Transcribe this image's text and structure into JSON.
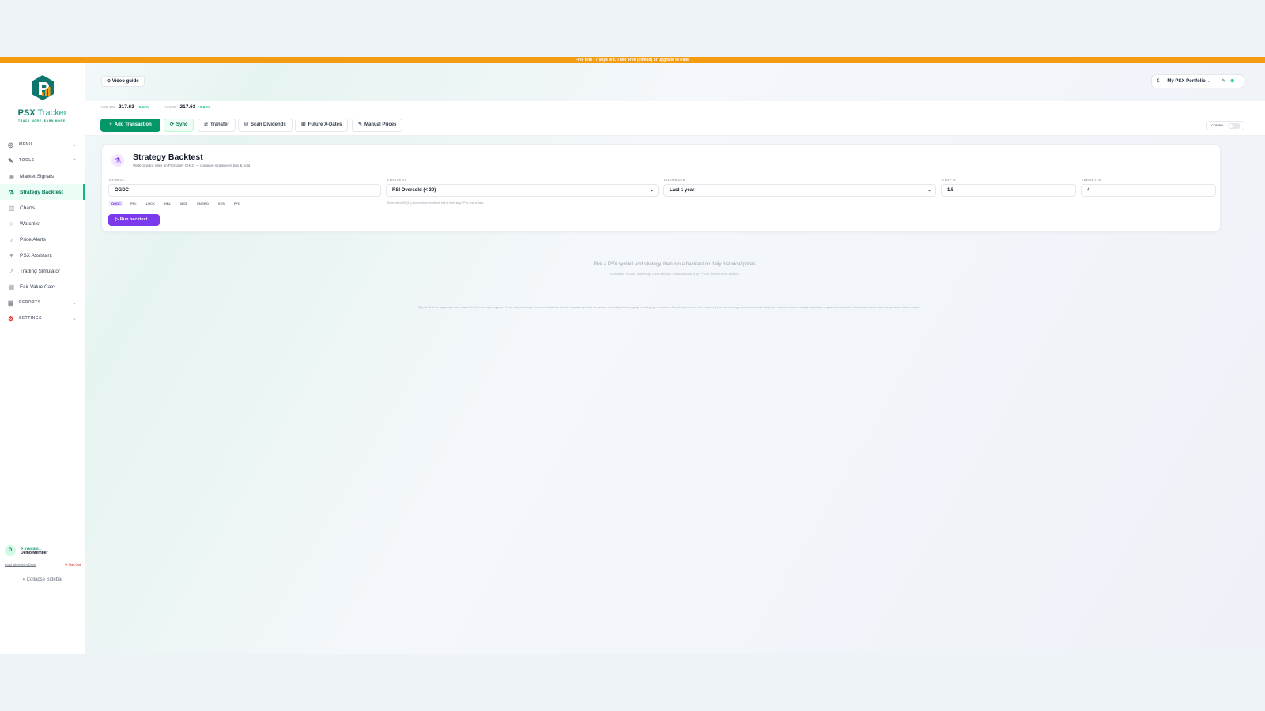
{
  "banner": "Free trial · 7 days left. Then Free (limited) or upgrade to Paid.",
  "brand": {
    "name_a": "PSX",
    "name_b": " Tracker",
    "tagline": "TRACK MORE. EARN MORE."
  },
  "colors": {
    "accent": "#059669",
    "brand": "#0f766e",
    "primary_action": "#7c3aed",
    "banner": "#f39c12"
  },
  "sidebar": {
    "menu_label": "MENU",
    "tools_label": "TOOLS",
    "items": [
      {
        "label": "Market Signals",
        "icon": "signal-icon",
        "active": false
      },
      {
        "label": "Strategy Backtest",
        "icon": "flask-icon",
        "active": true
      },
      {
        "label": "Charts",
        "icon": "chart-icon",
        "active": false
      },
      {
        "label": "Watchlist",
        "icon": "star-icon",
        "active": false
      },
      {
        "label": "Price Alerts",
        "icon": "bell-icon",
        "active": false
      },
      {
        "label": "PSX Assistant",
        "icon": "sparkle-icon",
        "active": false
      },
      {
        "label": "Trading Simulator",
        "icon": "trend-icon",
        "active": false
      },
      {
        "label": "Fair Value Calc",
        "icon": "calculator-icon",
        "active": false
      }
    ],
    "reports_label": "REPORTS",
    "settings_label": "SETTINGS",
    "user": {
      "initial": "D",
      "status": "SYNCING...",
      "name": "Demo Member",
      "load_link": "Load latest from Drive",
      "sign_out": "Sign Out"
    },
    "collapse": "Collapse Sidebar"
  },
  "header": {
    "video_guide": "Video guide",
    "portfolio": "My PSX Portfolio"
  },
  "tickers": [
    {
      "name": "KSE-100",
      "value": "217.63",
      "change": "+0.34%"
    },
    {
      "name": "KMI-30",
      "value": "217.63",
      "change": "+0.34%"
    }
  ],
  "actions": {
    "add": "Add Transaction",
    "sync": "Sync",
    "transfer": "Transfer",
    "scan": "Scan Dividends",
    "future": "Future X-Dates",
    "manual": "Manual Prices",
    "combo": "COMBO"
  },
  "backtest": {
    "title": "Strategy Backtest",
    "subtitle": "Walk-forward rules on PSX daily OHLC — compare strategy vs buy & hold",
    "symbol_label": "SYMBOL",
    "symbol_value": "OGDC",
    "strategy_label": "STRATEGY",
    "strategy_value": "RSI Oversold (< 30)",
    "lookback_label": "LOOKBACK",
    "lookback_value": "Last 1 year",
    "stop_label": "STOP %",
    "stop_value": "1.5",
    "target_label": "TARGET %",
    "target_value": "4",
    "chips": [
      "OGDC",
      "PPL",
      "LUCK",
      "HBL",
      "MCB",
      "ENGRO",
      "SYS",
      "FFC"
    ],
    "hint": "Enter when RSI(14) drops below threshold; exit at fixed stop/TP or end of data.",
    "run": "Run backtest",
    "empty_title": "Pick a PSX symbol and strategy, then run a backtest on daily historical prices.",
    "empty_sub": "Includes ~0.3% round-trip commission. Educational only — not investment advice.",
    "disclaimer": "Signals fill at the signal day close. Gaps fill at the next opening price. If both stop and target are crossed within a bar, the stop takes priority. Drawdown uses daily closing equity, including open positions. Round-trip fees are reserved at entry for both strategy and buy-and-hold. Daily bars cannot measure intraday drawdown or guarantee execution. Past performance does not guarantee future results."
  }
}
